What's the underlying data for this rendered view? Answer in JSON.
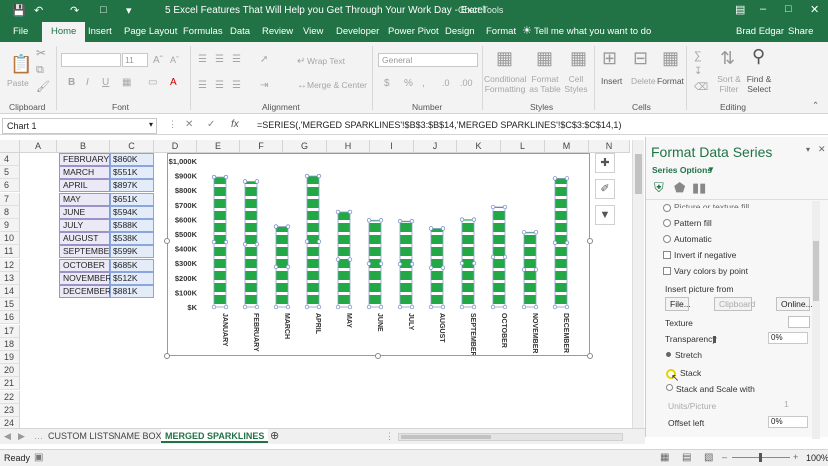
{
  "title_bar": {
    "document_title": "5 Excel Features That Will Help you Get Through Your Work Day - Excel",
    "chart_tools": "Chart Tools"
  },
  "tabs": [
    {
      "label": "File"
    },
    {
      "label": "Home"
    },
    {
      "label": "Insert"
    },
    {
      "label": "Page Layout"
    },
    {
      "label": "Formulas"
    },
    {
      "label": "Data"
    },
    {
      "label": "Review"
    },
    {
      "label": "View"
    },
    {
      "label": "Developer"
    },
    {
      "label": "Power Pivot"
    },
    {
      "label": "Design"
    },
    {
      "label": "Format"
    }
  ],
  "tell_me": "Tell me what you want to do",
  "user": "Brad Edgar",
  "share": "Share",
  "ribbon": {
    "paste": "Paste",
    "clipboard": "Clipboard",
    "font_size": "11",
    "font": "Font",
    "wrap_text": "Wrap Text",
    "merge_center": "Merge & Center",
    "alignment": "Alignment",
    "number_format": "General",
    "number": "Number",
    "conditional_formatting": "Conditional Formatting",
    "format_as_table": "Format as Table",
    "cell_styles": "Cell Styles",
    "styles": "Styles",
    "insert": "Insert",
    "delete": "Delete",
    "format": "Format",
    "cells": "Cells",
    "sort_filter": "Sort & Filter",
    "find_select": "Find & Select",
    "editing": "Editing"
  },
  "formula_bar": {
    "name_box": "Chart 1",
    "fx": "fx",
    "formula": "=SERIES(,'MERGED SPARKLINES'!$B$3:$B$14,'MERGED SPARKLINES'!$C$3:$C$14,1)"
  },
  "columns": [
    "A",
    "B",
    "C",
    "D",
    "E",
    "F",
    "G",
    "H",
    "I",
    "J",
    "K",
    "L",
    "M",
    "N"
  ],
  "rows": [
    "4",
    "5",
    "6",
    "7",
    "8",
    "9",
    "10",
    "11",
    "12",
    "13",
    "14",
    "15",
    "16",
    "17",
    "18",
    "19",
    "20",
    "21",
    "22",
    "23",
    "24"
  ],
  "months": [
    {
      "m": "FEBRUARY",
      "v": "$860K"
    },
    {
      "m": "MARCH",
      "v": "$551K"
    },
    {
      "m": "APRIL",
      "v": "$897K"
    },
    {
      "m": "MAY",
      "v": "$651K"
    },
    {
      "m": "JUNE",
      "v": "$594K"
    },
    {
      "m": "JULY",
      "v": "$588K"
    },
    {
      "m": "AUGUST",
      "v": "$538K"
    },
    {
      "m": "SEPTEMBER",
      "v": "$599K"
    },
    {
      "m": "OCTOBER",
      "v": "$685K"
    },
    {
      "m": "NOVEMBER",
      "v": "$512K"
    },
    {
      "m": "DECEMBER",
      "v": "$881K"
    }
  ],
  "chart_data": {
    "type": "bar",
    "categories": [
      "JANUARY",
      "FEBRUARY",
      "MARCH",
      "APRIL",
      "MAY",
      "JUNE",
      "JULY",
      "AUGUST",
      "SEPTEMBER",
      "OCTOBER",
      "NOVEMBER",
      "DECEMBER"
    ],
    "values": [
      890,
      860,
      551,
      897,
      651,
      594,
      588,
      538,
      599,
      685,
      512,
      881
    ],
    "ylim": [
      0,
      1000
    ],
    "ytick_labels": [
      "$1,000K",
      "$900K",
      "$800K",
      "$700K",
      "$600K",
      "$500K",
      "$400K",
      "$300K",
      "$200K",
      "$100K",
      "$K"
    ],
    "xlabel": "",
    "ylabel": "",
    "title": "",
    "grid": false,
    "bar_style": "picture stacked",
    "colors": {
      "accent": "#22a845"
    }
  },
  "sheet_tabs": [
    "CUSTOM LISTS",
    "NAME BOX",
    "MERGED SPARKLINES"
  ],
  "status": {
    "ready": "Ready",
    "zoom": "100%"
  },
  "pane": {
    "title": "Format Data Series",
    "series_options": "Series Options",
    "picture_or_texture_fill": "Picture or texture fill",
    "pattern_fill": "Pattern fill",
    "automatic": "Automatic",
    "invert": "Invert if negative",
    "vary": "Vary colors by point",
    "insert_from": "Insert picture from",
    "file_btn": "File...",
    "clipboard_btn": "Clipboard",
    "online_btn": "Online...",
    "texture": "Texture",
    "transparency": "Transparency",
    "transparency_value": "0%",
    "stretch": "Stretch",
    "stack": "Stack",
    "stack_scale": "Stack and Scale with",
    "units": "Units/Picture",
    "units_value": "1",
    "offset_left": "Offset left",
    "offset_value": "0%"
  }
}
